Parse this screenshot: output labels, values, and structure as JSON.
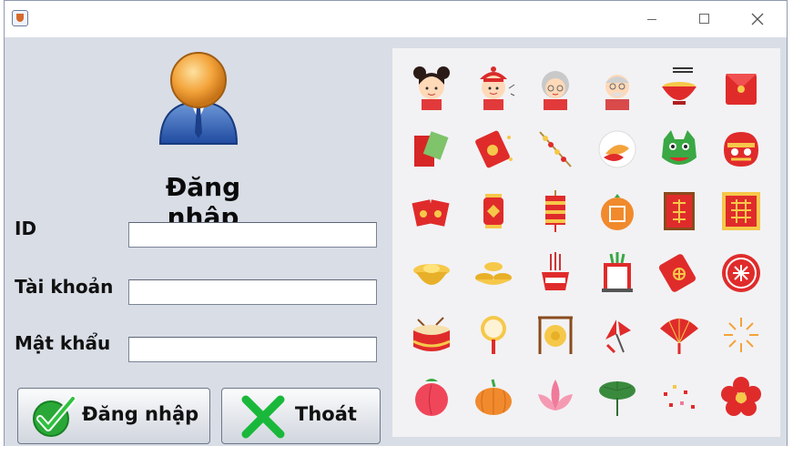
{
  "window": {
    "controls": [
      "minimize-icon",
      "maximize-icon",
      "close-icon"
    ]
  },
  "login": {
    "title": "Đăng nhập",
    "id_label": "ID",
    "account_label": "Tài khoản",
    "password_label": "Mật khẩu",
    "id_value": "",
    "account_value": "",
    "password_value": "",
    "login_button": "Đăng nhập",
    "exit_button": "Thoát"
  },
  "stickers": [
    "girl-sticker-icon",
    "boy-sticker-icon",
    "grandma-sticker-icon",
    "grandpa-sticker-icon",
    "noodle-bowl-icon",
    "red-envelope-icon",
    "lucky-money-icon",
    "red-packet-icon",
    "firecracker-icon",
    "koi-fish-icon",
    "dragon-head-icon",
    "lion-dance-icon",
    "envelopes-icon",
    "lantern-icon",
    "hanging-lantern-icon",
    "orange-fortune-icon",
    "phuc-scroll-icon",
    "double-happiness-icon",
    "gold-ingot-icon",
    "gold-ingots-pile-icon",
    "incense-pot-icon",
    "offering-frame-icon",
    "red-tag-knot-icon",
    "round-medallion-icon",
    "drum-icon",
    "hand-mirror-icon",
    "gong-icon",
    "fan-fireworks-icon",
    "red-fan-icon",
    "sparkle-burst-icon",
    "peach-icon",
    "pumpkin-icon",
    "lotus-icon",
    "lotus-leaf-icon",
    "confetti-icon",
    "plum-blossom-icon"
  ],
  "colors": {
    "panel": "#d9dde6",
    "accent_red": "#e02b2b",
    "check_green": "#2aa837"
  }
}
